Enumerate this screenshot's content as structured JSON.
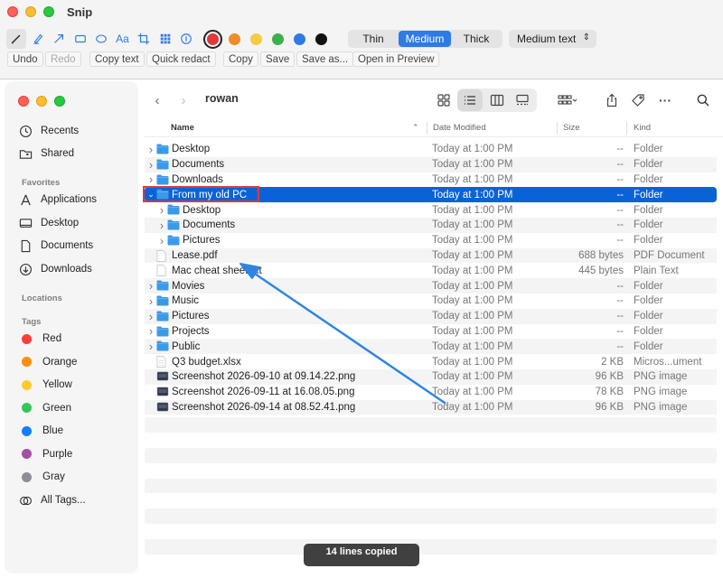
{
  "snip": {
    "title": "Snip",
    "tools": [
      "pen-icon",
      "highlighter-icon",
      "arrow-icon",
      "rectangle-icon",
      "ellipse-icon",
      "text-icon",
      "crop-icon",
      "pixelate-icon",
      "step-counter-icon"
    ],
    "tool_text_label": "Aa",
    "colors": [
      "#e0383e",
      "#f28c28",
      "#f7c945",
      "#3cb04a",
      "#2f7be6",
      "#111111"
    ],
    "selected_color": "#e0383e",
    "thickness": {
      "options": [
        "Thin",
        "Medium",
        "Thick"
      ],
      "selected": "Medium"
    },
    "text_size": "Medium text",
    "actions": {
      "undo": "Undo",
      "redo": "Redo",
      "copy_text": "Copy text",
      "quick_redact": "Quick redact",
      "copy": "Copy",
      "save": "Save",
      "save_as": "Save as...",
      "open_preview": "Open in Preview"
    },
    "toast": "14 lines copied"
  },
  "finder": {
    "location": "rowan",
    "sidebar": {
      "items": [
        {
          "label": "Recents",
          "icon": "clock-icon"
        },
        {
          "label": "Shared",
          "icon": "shared-folder-icon"
        }
      ],
      "favorites_heading": "Favorites",
      "favorites": [
        {
          "label": "Applications",
          "icon": "applications-icon"
        },
        {
          "label": "Desktop",
          "icon": "desktop-icon"
        },
        {
          "label": "Documents",
          "icon": "document-icon"
        },
        {
          "label": "Downloads",
          "icon": "download-icon"
        }
      ],
      "locations_heading": "Locations",
      "tags_heading": "Tags",
      "tags": [
        {
          "label": "Red",
          "color": "#fc3d39"
        },
        {
          "label": "Orange",
          "color": "#fd8d0e"
        },
        {
          "label": "Yellow",
          "color": "#fecb2f"
        },
        {
          "label": "Green",
          "color": "#33c759"
        },
        {
          "label": "Blue",
          "color": "#147efb"
        },
        {
          "label": "Purple",
          "color": "#a550a7"
        },
        {
          "label": "Gray",
          "color": "#8e8e93"
        }
      ],
      "all_tags": "All Tags..."
    },
    "columns": {
      "name": "Name",
      "date": "Date Modified",
      "size": "Size",
      "kind": "Kind"
    },
    "rows": [
      {
        "name": "Desktop",
        "date": "Today at 1:00 PM",
        "size": "--",
        "kind": "Folder"
      },
      {
        "name": "Documents",
        "date": "Today at 1:00 PM",
        "size": "--",
        "kind": "Folder"
      },
      {
        "name": "Downloads",
        "date": "Today at 1:00 PM",
        "size": "--",
        "kind": "Folder"
      },
      {
        "name": "From my old PC",
        "date": "Today at 1:00 PM",
        "size": "--",
        "kind": "Folder"
      },
      {
        "name": "Desktop",
        "date": "Today at 1:00 PM",
        "size": "--",
        "kind": "Folder"
      },
      {
        "name": "Documents",
        "date": "Today at 1:00 PM",
        "size": "--",
        "kind": "Folder"
      },
      {
        "name": "Pictures",
        "date": "Today at 1:00 PM",
        "size": "--",
        "kind": "Folder"
      },
      {
        "name": "Lease.pdf",
        "date": "Today at 1:00 PM",
        "size": "688 bytes",
        "kind": "PDF Document"
      },
      {
        "name": "Mac cheat sheet.txt",
        "date": "Today at 1:00 PM",
        "size": "445 bytes",
        "kind": "Plain Text"
      },
      {
        "name": "Movies",
        "date": "Today at 1:00 PM",
        "size": "--",
        "kind": "Folder"
      },
      {
        "name": "Music",
        "date": "Today at 1:00 PM",
        "size": "--",
        "kind": "Folder"
      },
      {
        "name": "Pictures",
        "date": "Today at 1:00 PM",
        "size": "--",
        "kind": "Folder"
      },
      {
        "name": "Projects",
        "date": "Today at 1:00 PM",
        "size": "--",
        "kind": "Folder"
      },
      {
        "name": "Public",
        "date": "Today at 1:00 PM",
        "size": "--",
        "kind": "Folder"
      },
      {
        "name": "Q3 budget.xlsx",
        "date": "Today at 1:00 PM",
        "size": "2 KB",
        "kind": "Micros...ument"
      },
      {
        "name": "Screenshot 2026-09-10 at 09.14.22.png",
        "date": "Today at 1:00 PM",
        "size": "96 KB",
        "kind": "PNG image"
      },
      {
        "name": "Screenshot 2026-09-11 at 16.08.05.png",
        "date": "Today at 1:00 PM",
        "size": "78 KB",
        "kind": "PNG image"
      },
      {
        "name": "Screenshot 2026-09-14 at 08.52.41.png",
        "date": "Today at 1:00 PM",
        "size": "96 KB",
        "kind": "PNG image"
      }
    ]
  }
}
